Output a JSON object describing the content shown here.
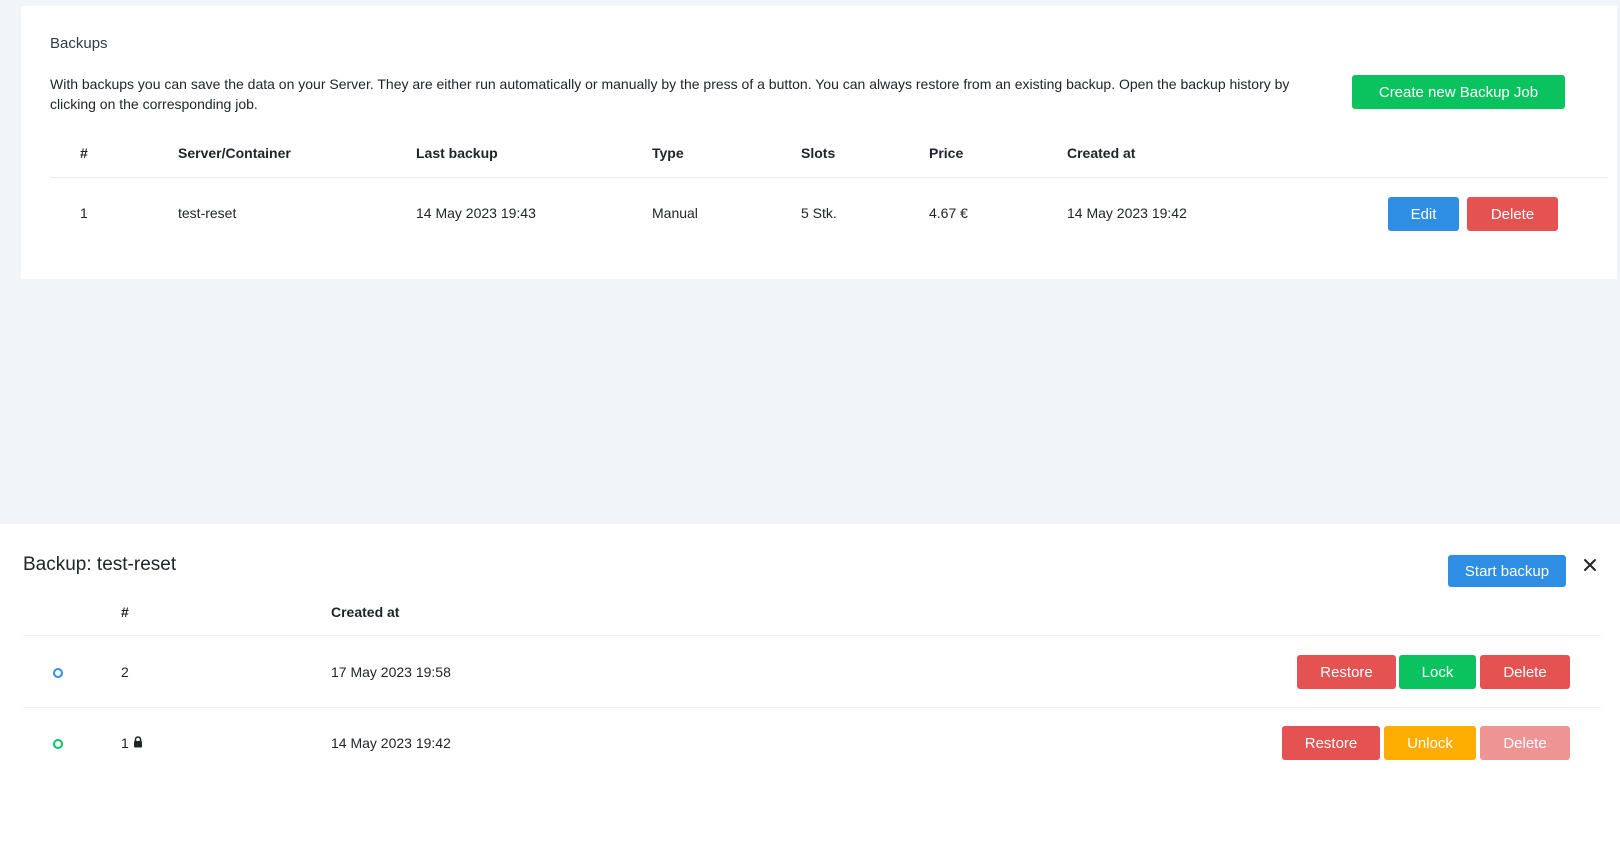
{
  "backups_card": {
    "title": "Backups",
    "description": "With backups you can save the data on your Server. They are either run automatically or manually by the press of a button. You can always restore from an existing backup. Open the backup history by clicking on the corresponding job.",
    "create_button": "Create new Backup Job",
    "columns": [
      "#",
      "Server/Container",
      "Last backup",
      "Type",
      "Slots",
      "Price",
      "Created at"
    ],
    "rows": [
      {
        "id": "1",
        "server": "test-reset",
        "last_backup": "14 May 2023 19:43",
        "type": "Manual",
        "slots": "5 Stk.",
        "price": "4.67 €",
        "created_at": "14 May 2023 19:42",
        "edit_label": "Edit",
        "delete_label": "Delete"
      }
    ]
  },
  "history_panel": {
    "title": "Backup: test-reset",
    "start_button": "Start backup",
    "close_icon": "close-icon",
    "columns": [
      "#",
      "Created at"
    ],
    "rows": [
      {
        "id": "2",
        "created_at": "17 May 2023 19:58",
        "status_color": "#2d8ee3",
        "locked": false,
        "restore_label": "Restore",
        "lock_label": "Lock",
        "delete_label": "Delete"
      },
      {
        "id": "1",
        "created_at": "14 May 2023 19:42",
        "status_color": "#0ac35e",
        "locked": true,
        "restore_label": "Restore",
        "lock_label": "Unlock",
        "delete_label": "Delete"
      }
    ]
  },
  "colors": {
    "green": "#0ac35e",
    "blue": "#2d8ee3",
    "red": "#e45352",
    "orange": "#fdad00",
    "red_disabled": "#ef9494",
    "page_bg": "#f1f5f8"
  }
}
